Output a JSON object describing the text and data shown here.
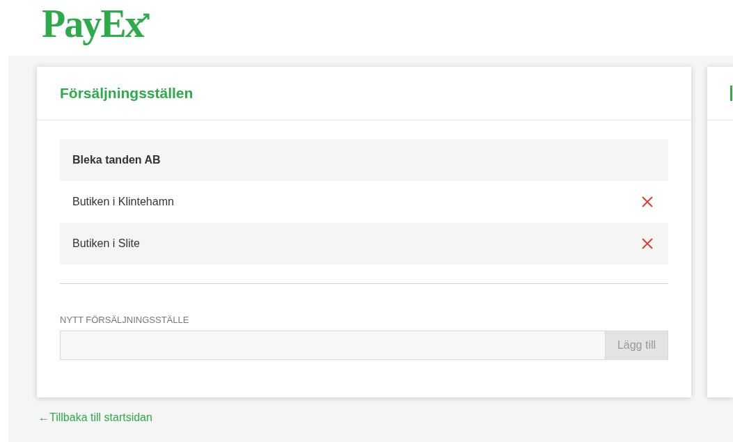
{
  "logo": {
    "text": "PayEx"
  },
  "card": {
    "title": "Försäljningsställen",
    "items": [
      {
        "kind": "company",
        "label": "Bleka tanden AB"
      },
      {
        "kind": "store",
        "label": "Butiken i Klintehamn"
      },
      {
        "kind": "store",
        "label": "Butiken i Slite"
      }
    ],
    "new_field": {
      "label": "NYTT FÖRSÄLJNINGSSTÄLLE",
      "button": "Lägg till",
      "button_disabled": true
    }
  },
  "back_link": {
    "arrow": "←",
    "text": "Tillbaka till startsidan"
  }
}
